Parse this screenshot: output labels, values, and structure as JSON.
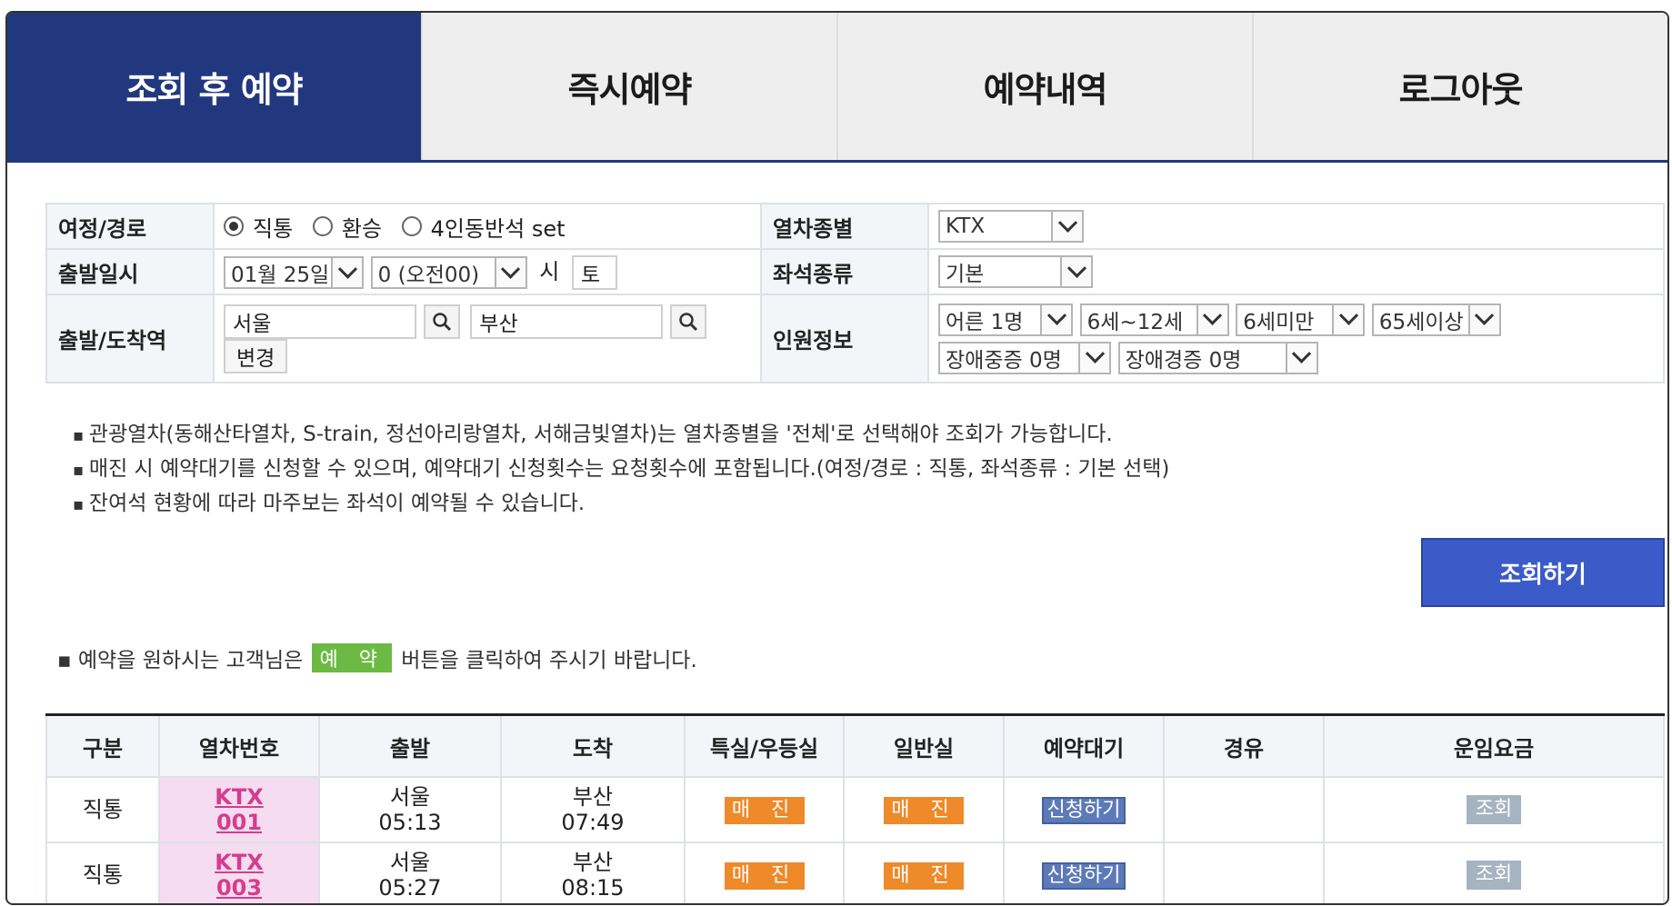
{
  "tabs": [
    {
      "label": "조회 후 예약",
      "active": true
    },
    {
      "label": "즉시예약",
      "active": false
    },
    {
      "label": "예약내역",
      "active": false
    },
    {
      "label": "로그아웃",
      "active": false
    }
  ],
  "form": {
    "route_label": "여정/경로",
    "route_options": [
      "직통",
      "환승",
      "4인동반석 set"
    ],
    "route_selected": "직통",
    "train_type_label": "열차종별",
    "train_type_value": "KTX",
    "depart_label": "출발일시",
    "depart_date": "01월 25일",
    "depart_hour": "0 (오전00)",
    "hour_suffix": "시",
    "weekday": "토",
    "seat_type_label": "좌석종류",
    "seat_type_value": "기본",
    "station_label": "출발/도착역",
    "from_station": "서울",
    "to_station": "부산",
    "change_button": "변경",
    "people_label": "인원정보",
    "people": [
      "어른 1명",
      "6세~12세",
      "6세미만",
      "65세이상",
      "장애중증 0명",
      "장애경증 0명"
    ]
  },
  "notes": [
    "관광열차(동해산타열차, S-train, 정선아리랑열차, 서해금빛열차)는 열차종별을 '전체'로 선택해야 조회가 가능합니다.",
    "매진 시 예약대기를 신청할 수 있으며, 예약대기 신청횟수는 요청횟수에 포함됩니다.(여정/경로 : 직통, 좌석종류 : 기본 선택)",
    "잔여석 현황에 따라 마주보는 좌석이 예약될 수 있습니다."
  ],
  "search_button": "조회하기",
  "hint": {
    "before": "▪ 예약을 원하시는 고객님은",
    "button": "예 약",
    "after": "버튼을 클릭하여 주시기 바랍니다."
  },
  "results": {
    "headers": [
      "구분",
      "열차번호",
      "출발",
      "도착",
      "특실/우등실",
      "일반실",
      "예약대기",
      "경유",
      "운임요금"
    ],
    "rows": [
      {
        "type": "직통",
        "train_name": "KTX",
        "train_no": "001",
        "from": "서울",
        "dep_time": "05:13",
        "to": "부산",
        "arr_time": "07:49",
        "first": "매 진",
        "standard": "매 진",
        "wait": "신청하기",
        "via": "",
        "fare": "조회"
      },
      {
        "type": "직통",
        "train_name": "KTX",
        "train_no": "003",
        "from": "서울",
        "dep_time": "05:27",
        "to": "부산",
        "arr_time": "08:15",
        "first": "매 진",
        "standard": "매 진",
        "wait": "신청하기",
        "via": "",
        "fare": "조회"
      }
    ]
  },
  "colors": {
    "tab_active": "#22387e",
    "search_button": "#3a5bc8",
    "soldout": "#ee8a2a",
    "reserve": "#6cba44",
    "train_cell": "#f5dcf0"
  }
}
